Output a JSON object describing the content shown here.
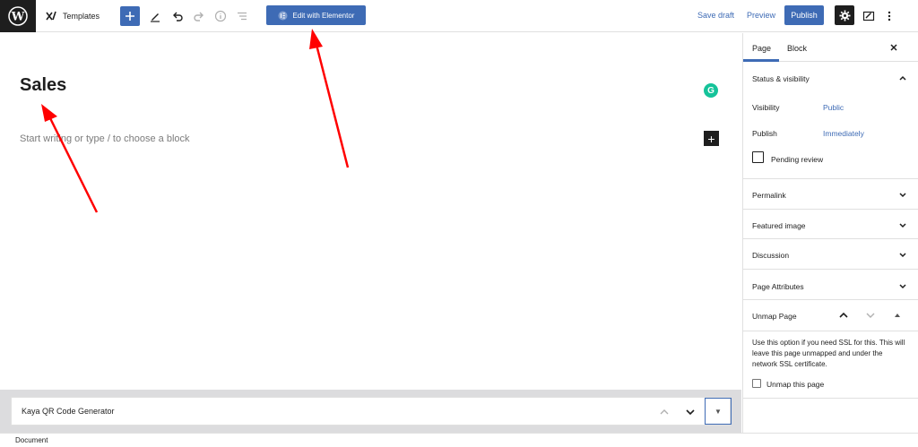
{
  "toolbar": {
    "templates_label": "Templates",
    "elementor_label": "Edit with Elementor",
    "save_draft_label": "Save draft",
    "preview_label": "Preview",
    "publish_label": "Publish"
  },
  "editor": {
    "title": "Sales",
    "placeholder": "Start writing or type / to choose a block"
  },
  "metabox": {
    "title": "Kaya QR Code Generator"
  },
  "statusbar": {
    "breadcrumb": "Document"
  },
  "sidebar": {
    "tabs": [
      {
        "label": "Page",
        "active": true
      },
      {
        "label": "Block",
        "active": false
      }
    ],
    "status_visibility": {
      "title": "Status & visibility",
      "visibility_label": "Visibility",
      "visibility_value": "Public",
      "publish_label": "Publish",
      "publish_value": "Immediately",
      "pending_review_label": "Pending review"
    },
    "panels": [
      {
        "title": "Permalink"
      },
      {
        "title": "Featured image"
      },
      {
        "title": "Discussion"
      },
      {
        "title": "Page Attributes"
      }
    ],
    "unmap": {
      "title": "Unmap Page",
      "description": "Use this option if you need SSL for this. This will leave this page unmapped and under the network SSL certificate.",
      "checkbox_label": "Unmap this page"
    }
  },
  "colors": {
    "accent": "#3e6bb5",
    "annotation_arrow": "#ff0000"
  }
}
